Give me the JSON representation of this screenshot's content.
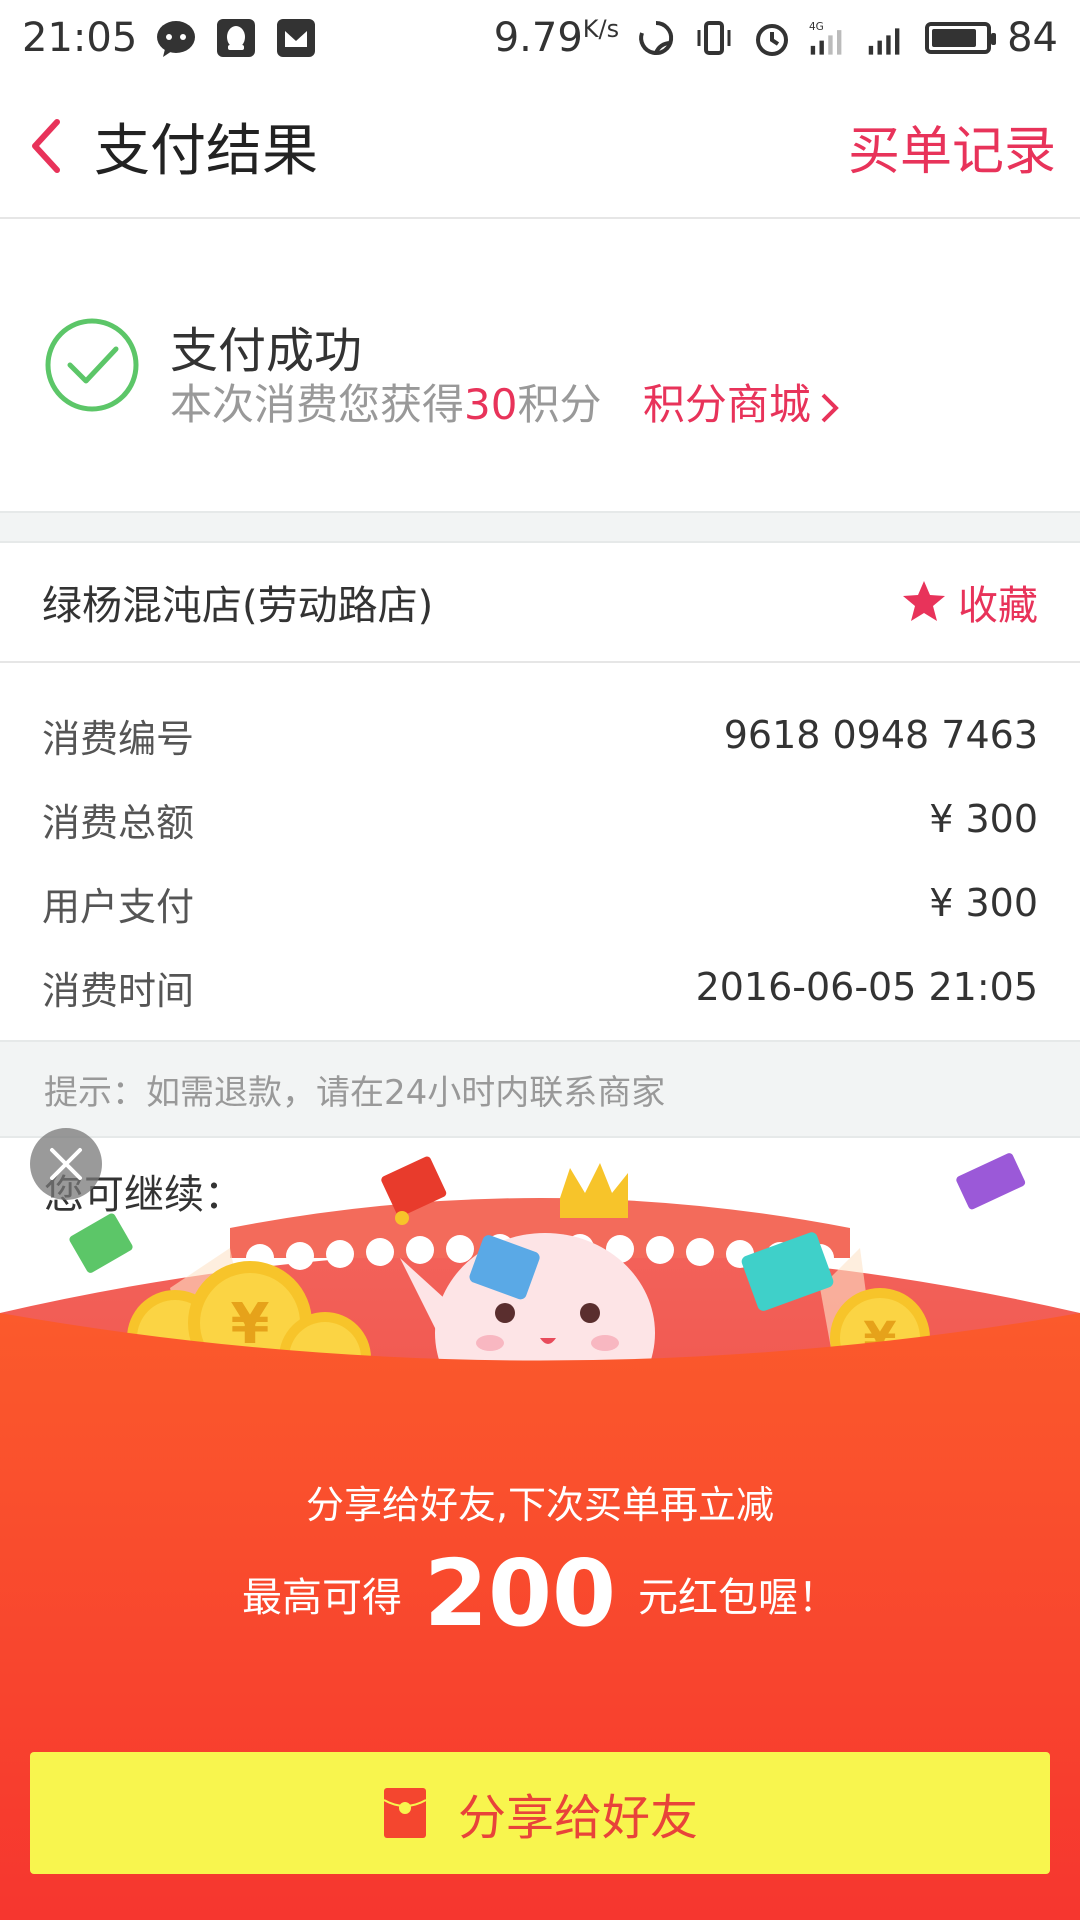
{
  "status_bar": {
    "time": "21:05",
    "speed": "9.79",
    "speed_unit": "K/s",
    "network": "4G",
    "battery": "84",
    "battery_level": 0.84
  },
  "header": {
    "title": "支付结果",
    "record_link": "买单记录"
  },
  "success": {
    "title": "支付成功",
    "sub_prefix": "本次消费您获得",
    "points": "30",
    "sub_suffix": "积分",
    "mall_link": "积分商城"
  },
  "store": {
    "name": "绿杨混沌店(劳动路店)",
    "favorite_label": "收藏"
  },
  "details": [
    {
      "label": "消费编号",
      "value": "9618 0948 7463"
    },
    {
      "label": "消费总额",
      "value": "¥ 300"
    },
    {
      "label": "用户支付",
      "value": "¥ 300"
    },
    {
      "label": "消费时间",
      "value": "2016-06-05 21:05"
    }
  ],
  "tip": "提示：如需退款，请在24小时内联系商家",
  "continue_label": "您可继续：",
  "promo": {
    "line1": "分享给好友,下次买单再立减",
    "line2_prefix": "最高可得",
    "amount": "200",
    "line2_suffix": "元红包喔！",
    "share_button": "分享给好友"
  },
  "colors": {
    "accent": "#e8335a",
    "success_green": "#5cc668",
    "envelope_red": "#f4462f",
    "button_yellow": "#f8f54e"
  }
}
